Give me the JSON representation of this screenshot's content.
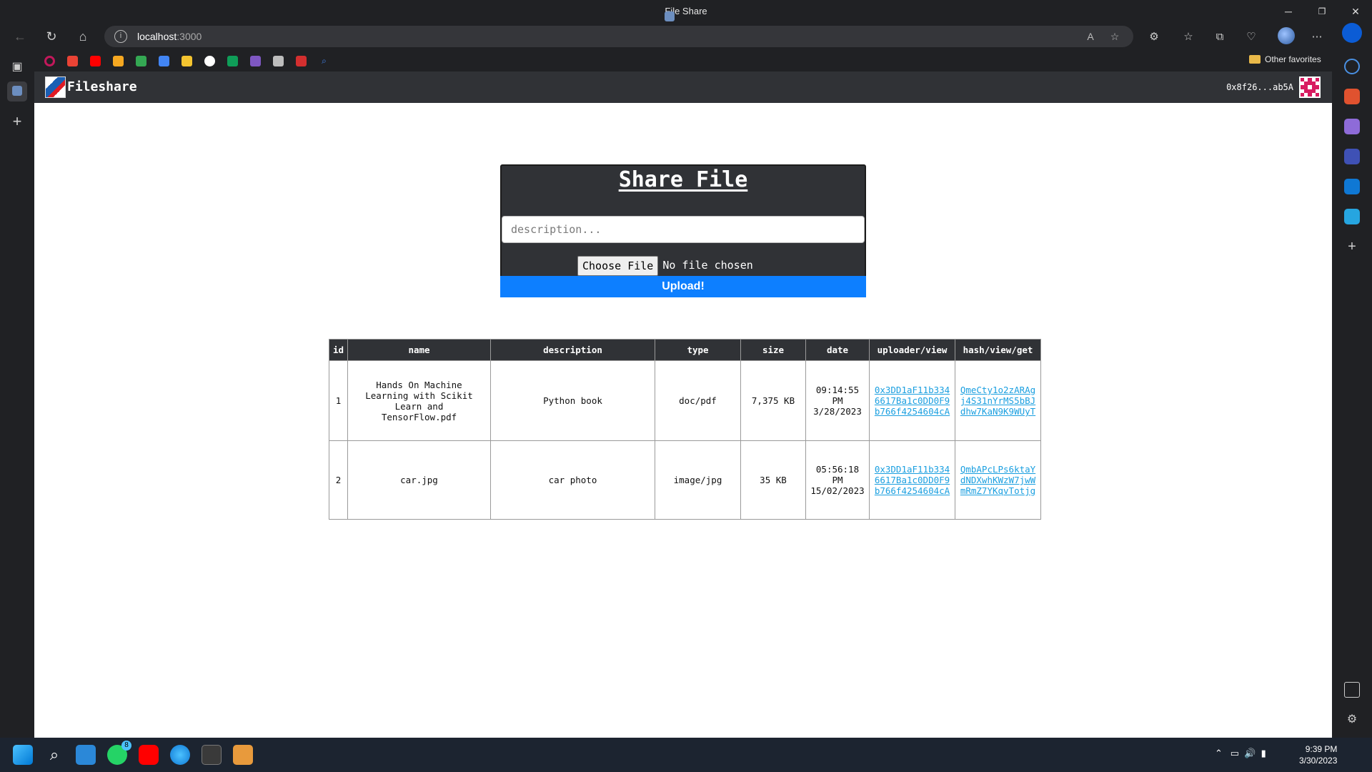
{
  "window": {
    "title": "File Share",
    "minimize_icon": "─",
    "restore_icon": "❐",
    "close_icon": "✕"
  },
  "browser": {
    "url_host": "localhost",
    "url_port": ":3000",
    "other_favorites": "Other favorites"
  },
  "app": {
    "name": "Fileshare",
    "account": "0x8f26...ab5A"
  },
  "share": {
    "heading": "Share File",
    "description_placeholder": "description...",
    "choose_file_label": "Choose File",
    "no_file_text": "No file chosen",
    "upload_label": "Upload!"
  },
  "table": {
    "headers": [
      "id",
      "name",
      "description",
      "type",
      "size",
      "date",
      "uploader/view",
      "hash/view/get"
    ],
    "rows": [
      {
        "id": "1",
        "name": "Hands On Machine Learning with Scikit Learn and TensorFlow.pdf",
        "description": "Python book",
        "type": "doc/pdf",
        "size": "7,375 KB",
        "time": "09:14:55",
        "ampm": "PM",
        "date": "3/28/2023",
        "uploader": "0x3DD1aF11b3346617Ba1c0DD0F9b766f4254604cA",
        "hash": "QmeCty1o2zARAgj4S31nYrMS5bBJdhw7KaN9K9WUyT"
      },
      {
        "id": "2",
        "name": "car.jpg",
        "description": "car photo",
        "type": "image/jpg",
        "size": "35 KB",
        "time": "05:56:18",
        "ampm": "PM",
        "date": "15/02/2023",
        "uploader": "0x3DD1aF11b3346617Ba1c0DD0F9b766f4254604cA",
        "hash": "QmbAPcLPs6ktaYdNDXwhKWzW7jwWmRmZ7YKqvTotjg"
      }
    ]
  },
  "taskbar": {
    "whatsapp_badge": "8",
    "time": "9:39 PM",
    "date": "3/30/2023"
  },
  "colors": {
    "accent_blue": "#0d7fff",
    "link": "#1a9fe0",
    "header_dark": "#303236"
  }
}
